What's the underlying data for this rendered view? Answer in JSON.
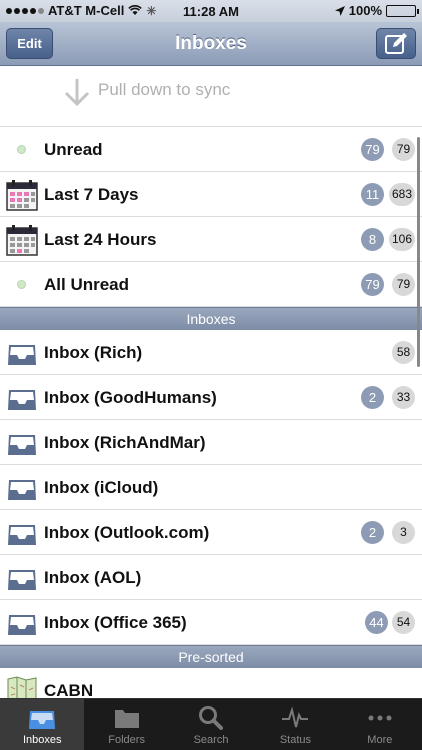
{
  "status_bar": {
    "carrier": "AT&T M-Cell",
    "time": "11:28 AM",
    "battery": "100%"
  },
  "nav": {
    "title": "Inboxes",
    "edit_label": "Edit"
  },
  "pull_to_sync": "Pull down to sync",
  "smart_folders": [
    {
      "label": "Unread",
      "icon": "bullet",
      "badge_dark": "79",
      "badge_light": "79"
    },
    {
      "label": "Last 7 Days",
      "icon": "calendar-icon",
      "badge_dark": "11",
      "badge_light": "683"
    },
    {
      "label": "Last 24 Hours",
      "icon": "calendar-icon",
      "badge_dark": "8",
      "badge_light": "106"
    },
    {
      "label": "All Unread",
      "icon": "bullet",
      "badge_dark": "79",
      "badge_light": "79"
    }
  ],
  "inboxes_header": "Inboxes",
  "inboxes": [
    {
      "label": "Inbox (Rich)",
      "badge_dark": null,
      "badge_light": "58"
    },
    {
      "label": "Inbox (GoodHumans)",
      "badge_dark": "2",
      "badge_light": "33"
    },
    {
      "label": "Inbox (RichAndMar)",
      "badge_dark": null,
      "badge_light": null
    },
    {
      "label": "Inbox (iCloud)",
      "badge_dark": null,
      "badge_light": null
    },
    {
      "label": "Inbox (Outlook.com)",
      "badge_dark": "2",
      "badge_light": "3"
    },
    {
      "label": "Inbox (AOL)",
      "badge_dark": null,
      "badge_light": null
    },
    {
      "label": "Inbox (Office 365)",
      "badge_dark": "44",
      "badge_light": "54"
    }
  ],
  "presorted_header": "Pre-sorted",
  "presorted": [
    {
      "label": "CABN",
      "icon": "map-icon"
    }
  ],
  "tabs": [
    {
      "label": "Inboxes",
      "icon": "inbox-tray-icon",
      "active": true
    },
    {
      "label": "Folders",
      "icon": "folder-icon",
      "active": false
    },
    {
      "label": "Search",
      "icon": "search-icon",
      "active": false
    },
    {
      "label": "Status",
      "icon": "pulse-icon",
      "active": false
    },
    {
      "label": "More",
      "icon": "more-dots-icon",
      "active": false
    }
  ],
  "colors": {
    "nav_bar": "#8b9bb6",
    "badge_dark": "#8e9bb4",
    "badge_light": "#d8d8d8",
    "tab_bar": "#1b1b1b",
    "active_tab_icon": "#4a90e2"
  }
}
